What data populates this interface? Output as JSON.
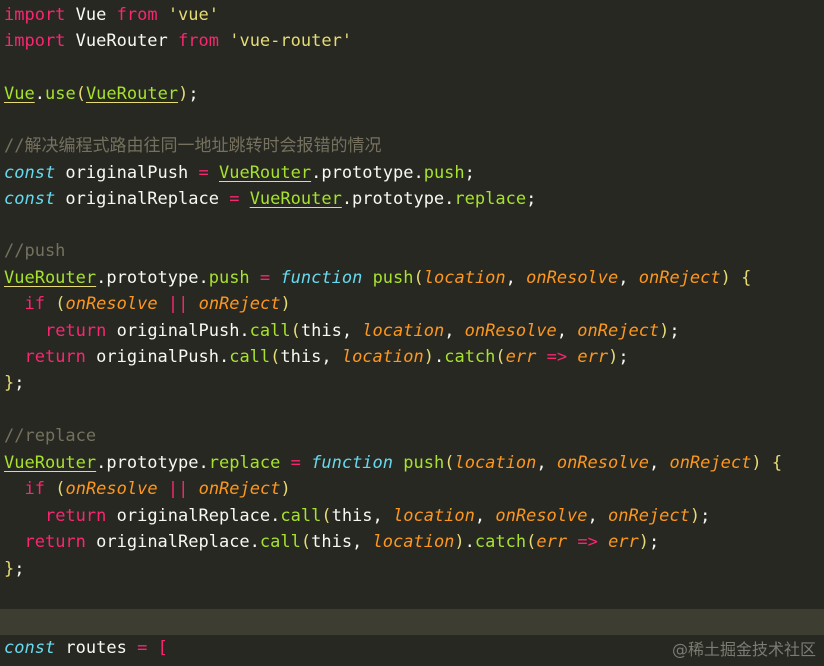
{
  "lines": [
    [
      [
        "kw",
        "import"
      ],
      [
        "plain",
        " Vue "
      ],
      [
        "kw",
        "from"
      ],
      [
        "plain",
        " "
      ],
      [
        "str",
        "'vue'"
      ]
    ],
    [
      [
        "kw",
        "import"
      ],
      [
        "plain",
        " VueRouter "
      ],
      [
        "kw",
        "from"
      ],
      [
        "plain",
        " "
      ],
      [
        "str",
        "'vue-router'"
      ]
    ],
    [],
    [
      [
        "cls",
        "Vue"
      ],
      [
        "plain",
        "."
      ],
      [
        "fn",
        "use"
      ],
      [
        "paren",
        "("
      ],
      [
        "cls",
        "VueRouter"
      ],
      [
        "paren",
        ")"
      ],
      [
        "plain",
        ";"
      ]
    ],
    [],
    [
      [
        "cmt",
        "//解决编程式路由往同一地址跳转时会报错的情况"
      ]
    ],
    [
      [
        "stor",
        "const"
      ],
      [
        "plain",
        " originalPush "
      ],
      [
        "op",
        "="
      ],
      [
        "plain",
        " "
      ],
      [
        "cls",
        "VueRouter"
      ],
      [
        "plain",
        ".prototype."
      ],
      [
        "fn",
        "push"
      ],
      [
        "plain",
        ";"
      ]
    ],
    [
      [
        "stor",
        "const"
      ],
      [
        "plain",
        " originalReplace "
      ],
      [
        "op",
        "="
      ],
      [
        "plain",
        " "
      ],
      [
        "cls",
        "VueRouter"
      ],
      [
        "plain",
        ".prototype."
      ],
      [
        "fn",
        "replace"
      ],
      [
        "plain",
        ";"
      ]
    ],
    [],
    [
      [
        "cmt",
        "//push"
      ]
    ],
    [
      [
        "cls",
        "VueRouter"
      ],
      [
        "plain",
        ".prototype."
      ],
      [
        "fn",
        "push"
      ],
      [
        "plain",
        " "
      ],
      [
        "op",
        "="
      ],
      [
        "plain",
        " "
      ],
      [
        "stor",
        "function"
      ],
      [
        "plain",
        " "
      ],
      [
        "fn",
        "push"
      ],
      [
        "paren",
        "("
      ],
      [
        "param",
        "location"
      ],
      [
        "plain",
        ", "
      ],
      [
        "param",
        "onResolve"
      ],
      [
        "plain",
        ", "
      ],
      [
        "param",
        "onReject"
      ],
      [
        "paren",
        ")"
      ],
      [
        "plain",
        " "
      ],
      [
        "paren",
        "{"
      ]
    ],
    [
      [
        "plain",
        "  "
      ],
      [
        "kw",
        "if"
      ],
      [
        "plain",
        " "
      ],
      [
        "paren",
        "("
      ],
      [
        "param",
        "onResolve"
      ],
      [
        "plain",
        " "
      ],
      [
        "op",
        "||"
      ],
      [
        "plain",
        " "
      ],
      [
        "param",
        "onReject"
      ],
      [
        "paren",
        ")"
      ]
    ],
    [
      [
        "plain",
        "    "
      ],
      [
        "kw",
        "return"
      ],
      [
        "plain",
        " originalPush."
      ],
      [
        "fn",
        "call"
      ],
      [
        "paren",
        "("
      ],
      [
        "plain",
        "this, "
      ],
      [
        "param",
        "location"
      ],
      [
        "plain",
        ", "
      ],
      [
        "param",
        "onResolve"
      ],
      [
        "plain",
        ", "
      ],
      [
        "param",
        "onReject"
      ],
      [
        "paren",
        ")"
      ],
      [
        "plain",
        ";"
      ]
    ],
    [
      [
        "plain",
        "  "
      ],
      [
        "kw",
        "return"
      ],
      [
        "plain",
        " originalPush."
      ],
      [
        "fn",
        "call"
      ],
      [
        "paren",
        "("
      ],
      [
        "plain",
        "this, "
      ],
      [
        "param",
        "location"
      ],
      [
        "paren",
        ")"
      ],
      [
        "plain",
        "."
      ],
      [
        "fn",
        "catch"
      ],
      [
        "paren",
        "("
      ],
      [
        "param",
        "err"
      ],
      [
        "plain",
        " "
      ],
      [
        "op",
        "=>"
      ],
      [
        "plain",
        " "
      ],
      [
        "param",
        "err"
      ],
      [
        "paren",
        ")"
      ],
      [
        "plain",
        ";"
      ]
    ],
    [
      [
        "paren",
        "}"
      ],
      [
        "plain",
        ";"
      ]
    ],
    [],
    [
      [
        "cmt",
        "//replace"
      ]
    ],
    [
      [
        "cls",
        "VueRouter"
      ],
      [
        "plain",
        ".prototype."
      ],
      [
        "fn",
        "replace"
      ],
      [
        "plain",
        " "
      ],
      [
        "op",
        "="
      ],
      [
        "plain",
        " "
      ],
      [
        "stor",
        "function"
      ],
      [
        "plain",
        " "
      ],
      [
        "fn",
        "push"
      ],
      [
        "paren",
        "("
      ],
      [
        "param",
        "location"
      ],
      [
        "plain",
        ", "
      ],
      [
        "param",
        "onResolve"
      ],
      [
        "plain",
        ", "
      ],
      [
        "param",
        "onReject"
      ],
      [
        "paren",
        ")"
      ],
      [
        "plain",
        " "
      ],
      [
        "paren",
        "{"
      ]
    ],
    [
      [
        "plain",
        "  "
      ],
      [
        "kw",
        "if"
      ],
      [
        "plain",
        " "
      ],
      [
        "paren",
        "("
      ],
      [
        "param",
        "onResolve"
      ],
      [
        "plain",
        " "
      ],
      [
        "op",
        "||"
      ],
      [
        "plain",
        " "
      ],
      [
        "param",
        "onReject"
      ],
      [
        "paren",
        ")"
      ]
    ],
    [
      [
        "plain",
        "    "
      ],
      [
        "kw",
        "return"
      ],
      [
        "plain",
        " originalReplace."
      ],
      [
        "fn",
        "call"
      ],
      [
        "paren",
        "("
      ],
      [
        "plain",
        "this, "
      ],
      [
        "param",
        "location"
      ],
      [
        "plain",
        ", "
      ],
      [
        "param",
        "onResolve"
      ],
      [
        "plain",
        ", "
      ],
      [
        "param",
        "onReject"
      ],
      [
        "paren",
        ")"
      ],
      [
        "plain",
        ";"
      ]
    ],
    [
      [
        "plain",
        "  "
      ],
      [
        "kw",
        "return"
      ],
      [
        "plain",
        " originalReplace."
      ],
      [
        "fn",
        "call"
      ],
      [
        "paren",
        "("
      ],
      [
        "plain",
        "this, "
      ],
      [
        "param",
        "location"
      ],
      [
        "paren",
        ")"
      ],
      [
        "plain",
        "."
      ],
      [
        "fn",
        "catch"
      ],
      [
        "paren",
        "("
      ],
      [
        "param",
        "err"
      ],
      [
        "plain",
        " "
      ],
      [
        "op",
        "=>"
      ],
      [
        "plain",
        " "
      ],
      [
        "param",
        "err"
      ],
      [
        "paren",
        ")"
      ],
      [
        "plain",
        ";"
      ]
    ],
    [
      [
        "paren",
        "}"
      ],
      [
        "plain",
        ";"
      ]
    ],
    [],
    [],
    [],
    [
      [
        "stor",
        "const"
      ],
      [
        "plain",
        " routes "
      ],
      [
        "op",
        "="
      ],
      [
        "plain",
        " "
      ],
      [
        "bracket",
        "["
      ]
    ]
  ],
  "colors": {
    "background": "#272822",
    "current_line": "#3E3D32",
    "keyword": "#F92672",
    "string": "#E6DB74",
    "function": "#A6E22E",
    "comment": "#75715E",
    "storage": "#66D9EF",
    "parameter": "#FD971F"
  },
  "watermark": "@稀土掘金技术社区"
}
